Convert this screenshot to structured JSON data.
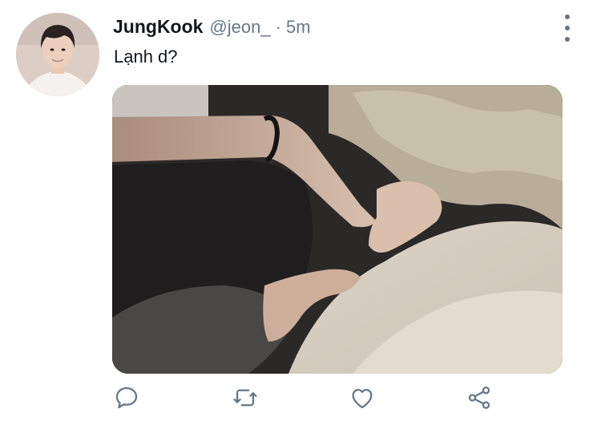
{
  "tweet": {
    "display_name": "JungKook",
    "handle": "@jeon_",
    "separator": "·",
    "time": "5m",
    "text": "Lạnh d?"
  },
  "icons": {
    "more": "more-vertical-icon",
    "reply": "reply-icon",
    "retweet": "retweet-icon",
    "like": "heart-icon",
    "share": "share-icon"
  },
  "colors": {
    "name": "#14171a",
    "secondary": "#657786",
    "background": "#ffffff"
  }
}
